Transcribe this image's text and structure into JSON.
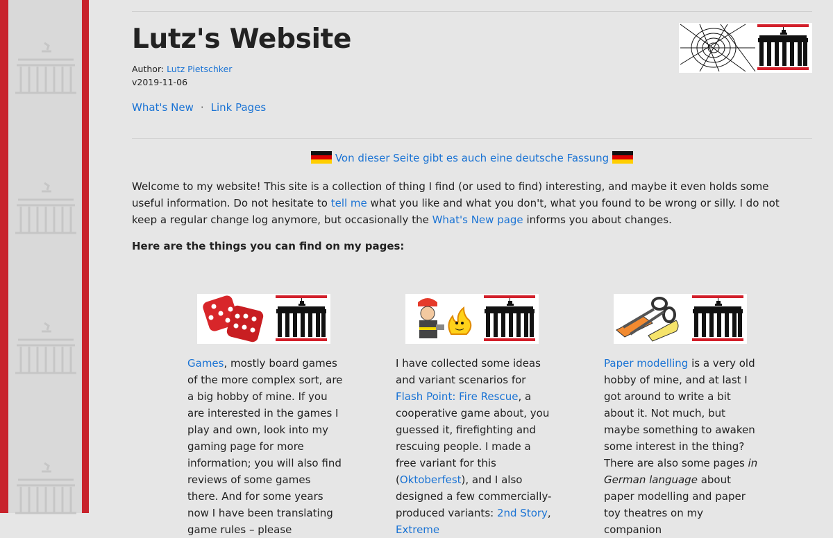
{
  "header": {
    "title": "Lutz's Website",
    "author_label": "Author:",
    "author_name": "Lutz Pietschker",
    "version": "v2019-11-06"
  },
  "nav": {
    "items": [
      "What's New",
      "Link Pages"
    ],
    "separator": "·"
  },
  "german_notice": "Von dieser Seite gibt es auch eine deutsche Fassung",
  "intro": {
    "part1": "Welcome to my website! This site is a collection of thing I find (or used to find) interesting, and maybe it even holds some useful information. Do not hesitate to ",
    "link1": "tell me",
    "part2": " what you like and what you don't, what you found to be wrong or silly. I do not keep a regular change log anymore, but occasionally the ",
    "link2": "What's New page",
    "part3": " informs you about changes."
  },
  "things_heading": "Here are the things you can find on my pages:",
  "cards": [
    {
      "icon": "dice-icon",
      "link": "Games",
      "text": ", mostly board games of the more complex sort, are a big hobby of mine. If you are interested in the games I play and own, look into my gaming page for more information; you will also find reviews of some games there. And for some years now I have been translating game rules – please"
    },
    {
      "icon": "firefighter-icon",
      "text1": "I have collected some ideas and variant scenarios for ",
      "link1": "Flash Point: Fire Rescue",
      "text2": ", a cooperative game about, you guessed it, firefighting and rescuing people. I made a free variant for this (",
      "link2": "Oktoberfest",
      "text3": "), and I also designed a few commercially-produced variants: ",
      "link3": "2nd Story",
      "text4": ", ",
      "link4": "Extreme"
    },
    {
      "icon": "scissors-icon",
      "link": "Paper modelling",
      "text1": " is a very old hobby of mine, and at last I got around to write a bit about it. Not much, but maybe something to awaken some interest in the thing?",
      "text2": "There are also some pages ",
      "italic": "in German language",
      "text3": " about paper modelling and paper toy theatres on my companion"
    }
  ],
  "colors": {
    "accent_red": "#c8232c",
    "link_blue": "#1a73d4",
    "background": "#e6e6e6"
  }
}
